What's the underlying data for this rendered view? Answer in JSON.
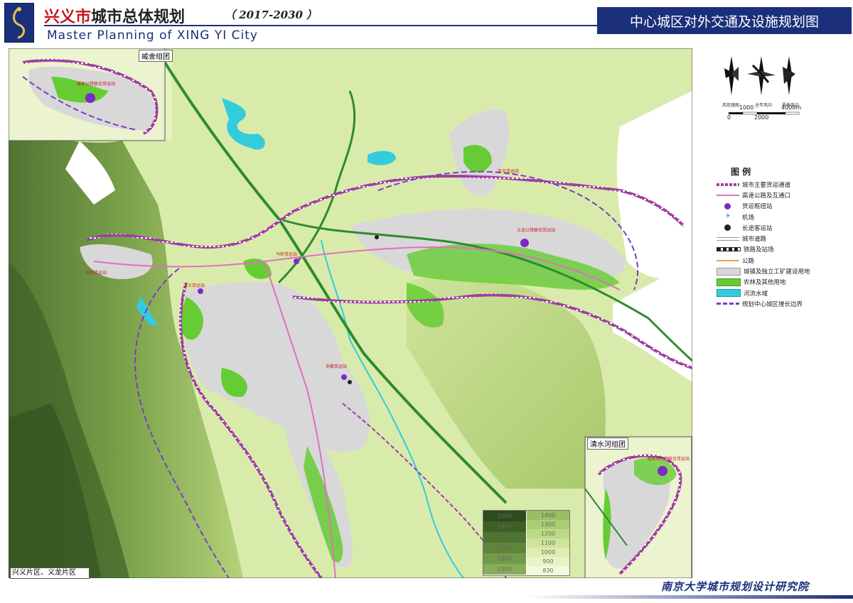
{
  "header": {
    "city_name": "兴义市",
    "plan_title": "城市总体规划",
    "years": "（ 2017-2030 ）",
    "english_title": "Master Planning of XING YI City",
    "map_title": "中心城区对外交通及设施规划图"
  },
  "insets": {
    "top_left": "威舍组团",
    "bottom_right": "清水河组团"
  },
  "compass": {
    "captions": [
      "风玫瑰图",
      "全年风向",
      "夏季风向"
    ]
  },
  "scale": {
    "labels": [
      "1000",
      "4000m",
      "0",
      "2000"
    ]
  },
  "legend": {
    "title": "图 例",
    "items": [
      {
        "label": "城市主要货运通道",
        "kind": "freight-corridor",
        "color": "#a040a0"
      },
      {
        "label": "高速公路及互通口",
        "kind": "expressway",
        "color": "#e070c0"
      },
      {
        "label": "货运枢纽站",
        "kind": "freight-hub",
        "color": "#7a2bc4"
      },
      {
        "label": "机场",
        "kind": "airport",
        "color": "#3a8acc"
      },
      {
        "label": "长途客运站",
        "kind": "bus-station",
        "color": "#222222"
      },
      {
        "label": "城市道路",
        "kind": "city-road",
        "color": "#999999"
      },
      {
        "label": "铁路及站场",
        "kind": "railway",
        "color": "#222222"
      },
      {
        "label": "公路",
        "kind": "highway",
        "color": "#f0a050"
      },
      {
        "label": "城镇及独立工矿建设用地",
        "kind": "urban-land",
        "color": "#d8d8d8"
      },
      {
        "label": "农林及其他用地",
        "kind": "farm-land",
        "color": "#66cc33"
      },
      {
        "label": "河流水域",
        "kind": "water",
        "color": "#33ccdd"
      },
      {
        "label": "规划中心城区增长边界",
        "kind": "growth-boundary",
        "color": "#7a3cc4"
      }
    ]
  },
  "stations": [
    {
      "label": "威舍公铁联合货运站"
    },
    {
      "label": "万屯货运站"
    },
    {
      "label": "义龙公铁联合货运站"
    },
    {
      "label": "马岭货运站"
    },
    {
      "label": "丰都货运站"
    },
    {
      "label": "万义货运站"
    },
    {
      "label": "马岭货运站"
    },
    {
      "label": "清水河公铁联合货运站"
    }
  ],
  "elevation": {
    "left": [
      "2000",
      "1900",
      "1800",
      "1700",
      "1600",
      "1500"
    ],
    "right": [
      "1400",
      "1300",
      "1200",
      "1100",
      "1000",
      "900",
      "830"
    ],
    "colors_left": [
      "#2e4a1e",
      "#3d5e25",
      "#4e7230",
      "#5f843b",
      "#729a48",
      "#86ad59"
    ],
    "colors_right": [
      "#98bf66",
      "#aacd74",
      "#bcd987",
      "#cde49a",
      "#dcedb0",
      "#e8f4c6",
      "#f3fadb"
    ]
  },
  "footer": {
    "district": "兴义片区、义龙片区",
    "institute": "南京大学城市规划设计研究院"
  }
}
